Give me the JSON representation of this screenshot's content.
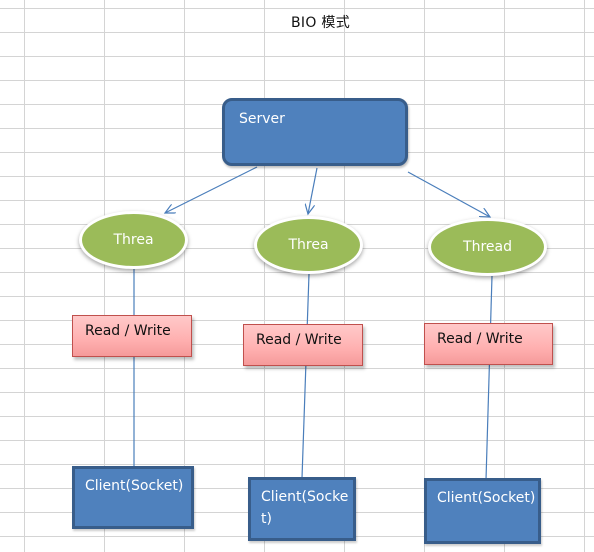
{
  "diagram": {
    "title": "BIO  模式",
    "server": {
      "label": "Server",
      "fill": "#4f81bd",
      "border": "#385d8a"
    },
    "threads": [
      {
        "label": "Threa",
        "fill": "#9bbb59"
      },
      {
        "label": "Threa",
        "fill": "#9bbb59"
      },
      {
        "label": "Thread",
        "fill": "#9bbb59"
      }
    ],
    "read_write": [
      {
        "label": "Read / Write",
        "fill": "#ffb9b9",
        "border": "#c0504d"
      },
      {
        "label": "Read / Write",
        "fill": "#ffb9b9",
        "border": "#c0504d"
      },
      {
        "label": "Read / Write",
        "fill": "#ffb9b9",
        "border": "#c0504d"
      }
    ],
    "clients": [
      {
        "label": "Client(Socket)"
      },
      {
        "label": "Client(Socket)"
      },
      {
        "label": "Client(Socket)"
      }
    ],
    "edges": [
      {
        "from": "server",
        "to": "thread-1",
        "arrow": true
      },
      {
        "from": "server",
        "to": "thread-2",
        "arrow": true
      },
      {
        "from": "server",
        "to": "thread-3",
        "arrow": true
      },
      {
        "from": "thread-1",
        "to": "client-1",
        "via": "read-write-1",
        "arrow": false
      },
      {
        "from": "thread-2",
        "to": "client-2",
        "via": "read-write-2",
        "arrow": false
      },
      {
        "from": "thread-3",
        "to": "client-3",
        "via": "read-write-3",
        "arrow": false
      }
    ],
    "line_color": "#4a7ebb"
  }
}
